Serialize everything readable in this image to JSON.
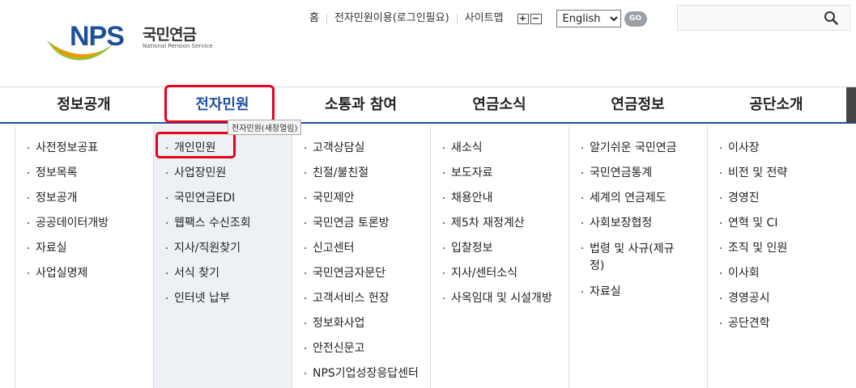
{
  "logo": {
    "mark": "NPS",
    "name_ko": "국민연금",
    "name_en": "National Pension Service"
  },
  "utility": {
    "links": [
      "홈",
      "전자민원이용(로그인필요)",
      "사이트맵"
    ],
    "zoom_in": "+",
    "zoom_out": "−",
    "language_selected": "English",
    "go_label": "GO",
    "search_placeholder": ""
  },
  "nav": {
    "items": [
      "정보공개",
      "전자민원",
      "소통과 참여",
      "연금소식",
      "연금정보",
      "공단소개"
    ],
    "active": "전자민원",
    "tooltip": "전자민원(새창열림)"
  },
  "submenu": [
    [
      "사전정보공표",
      "정보목록",
      "정보공개",
      "공공데이터개방",
      "자료실",
      "사업실명제"
    ],
    [
      "개인민원",
      "사업장민원",
      "국민연금EDI",
      "웹팩스 수신조회",
      "지사/직원찾기",
      "서식 찾기",
      "인터넷 납부"
    ],
    [
      "고객상담실",
      "친절/불친절",
      "국민제안",
      "국민연금 토론방",
      "신고센터",
      "국민연금자문단",
      "고객서비스 헌장",
      "정보화사업",
      "안전신문고",
      "NPS기업성장응답센터"
    ],
    [
      "새소식",
      "보도자료",
      "채용안내",
      "제5차 재정계산",
      "입찰정보",
      "지사/센터소식",
      "사옥임대 및 시설개방"
    ],
    [
      "알기쉬운 국민연금",
      "국민연금통계",
      "세계의 연금제도",
      "사회보장협정",
      "법령 및 사규(제규정)",
      "자료실"
    ],
    [
      "이사장",
      "비전 및 전략",
      "경영진",
      "연혁 및 CI",
      "조직 및 인원",
      "이사회",
      "경영공시",
      "공단견학"
    ]
  ],
  "colors": {
    "brand": "#1d4f9c",
    "highlight_box": "#e8001c",
    "submenu_highlight": "#edf1f5"
  },
  "icons": {
    "search": "search-icon"
  }
}
